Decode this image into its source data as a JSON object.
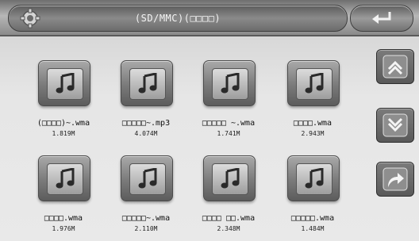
{
  "header": {
    "title": "(SD/MMC)(□□□□)",
    "settings_icon": "gear-icon",
    "back_icon": "return-arrow-icon"
  },
  "files": [
    {
      "name": "(□□□□)~.wma",
      "size": "1.819M"
    },
    {
      "name": "□□□□□~.mp3",
      "size": "4.074M"
    },
    {
      "name": "□□□□□ ~.wma",
      "size": "1.741M"
    },
    {
      "name": "□□□□.wma",
      "size": "2.943M"
    },
    {
      "name": "□□□□.wma",
      "size": "1.976M"
    },
    {
      "name": "□□□□□~.wma",
      "size": "2.110M"
    },
    {
      "name": "□□□□ □□.wma",
      "size": "2.348M"
    },
    {
      "name": "□□□□□.wma",
      "size": "1.484M"
    }
  ],
  "side_buttons": [
    {
      "icon": "scroll-up-icon"
    },
    {
      "icon": "scroll-down-icon"
    },
    {
      "icon": "jump-icon"
    }
  ],
  "file_icon": "music-note-icon"
}
